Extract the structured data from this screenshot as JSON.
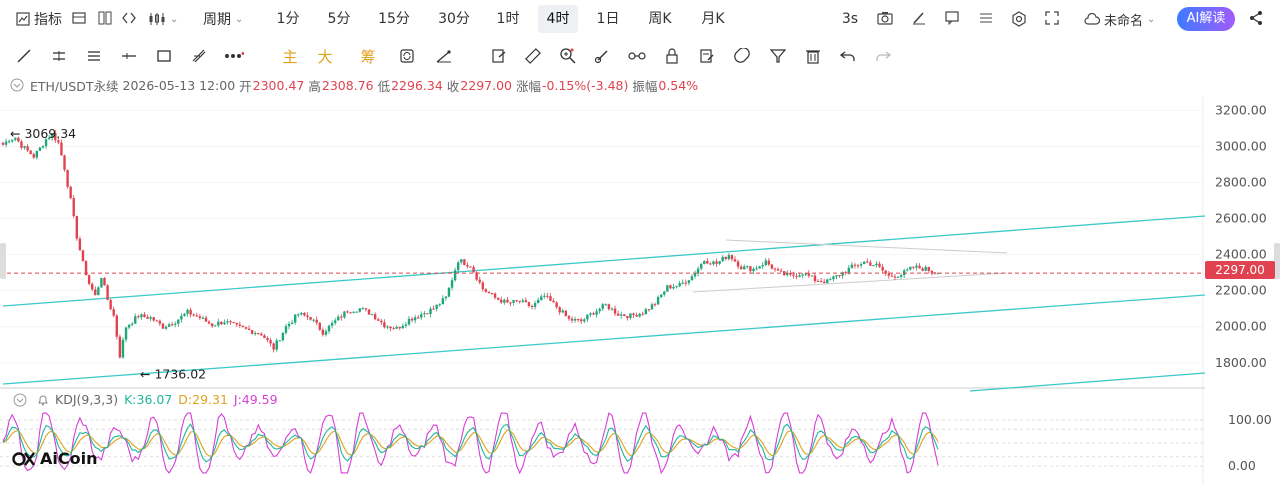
{
  "toolbar": {
    "indicator_label": "指标",
    "period_label": "周期",
    "timeframes": [
      "1分",
      "5分",
      "15分",
      "30分",
      "1时",
      "4时",
      "1日",
      "周K",
      "月K"
    ],
    "active_timeframe": "4时",
    "refresh_label": "3s",
    "layout_name": "未命名",
    "ai_label": "AI解读"
  },
  "draw_tools": {
    "main_label": "主",
    "big_label": "大",
    "chip_label": "筹"
  },
  "info_bar": {
    "symbol": "ETH/USDT永续",
    "datetime": "2026-05-13 12:00",
    "open_label": "开",
    "open": "2300.47",
    "high_label": "高",
    "high": "2308.76",
    "low_label": "低",
    "low": "2296.34",
    "close_label": "收",
    "close": "2297.00",
    "change_label": "涨幅",
    "change": "-0.15%(-3.48)",
    "amplitude_label": "振幅",
    "amplitude": "0.54%"
  },
  "kdj": {
    "title": "KDJ(9,3,3)",
    "k_text": "K:36.07",
    "d_text": "D:29.31",
    "j_text": "J:49.59",
    "k_color": "#1fb89b",
    "d_color": "#e0a21d",
    "j_color": "#d63fd6"
  },
  "brand": {
    "logo_text": "AiCoin"
  },
  "chart_data": {
    "type": "candlestick",
    "ylim": [
      1660,
      3280
    ],
    "y_ticks": [
      "3200.00",
      "3000.00",
      "2800.00",
      "2600.00",
      "2400.00",
      "2200.00",
      "2000.00",
      "1800.00"
    ],
    "y_tick_values": [
      3200,
      3000,
      2800,
      2600,
      2400,
      2200,
      2000,
      1800
    ],
    "last_price": 2297.0,
    "last_price_label": "2297.00",
    "annotations": [
      {
        "label": "3069.34",
        "value": 3069.34
      },
      {
        "label": "1736.02",
        "value": 1736.02
      }
    ],
    "close_path": [
      [
        0,
        3010
      ],
      [
        2,
        3040
      ],
      [
        4,
        3050
      ],
      [
        6,
        3005
      ],
      [
        8,
        2975
      ],
      [
        10,
        2945
      ],
      [
        12,
        2990
      ],
      [
        14,
        3040
      ],
      [
        16,
        3070
      ],
      [
        18,
        3020
      ],
      [
        20,
        2880
      ],
      [
        22,
        2700
      ],
      [
        24,
        2500
      ],
      [
        26,
        2350
      ],
      [
        28,
        2240
      ],
      [
        30,
        2170
      ],
      [
        32,
        2280
      ],
      [
        34,
        2150
      ],
      [
        36,
        2060
      ],
      [
        38,
        1840
      ],
      [
        40,
        2000
      ],
      [
        44,
        2060
      ],
      [
        48,
        2050
      ],
      [
        52,
        2000
      ],
      [
        56,
        2030
      ],
      [
        60,
        2080
      ],
      [
        64,
        2050
      ],
      [
        68,
        2010
      ],
      [
        72,
        2030
      ],
      [
        76,
        2000
      ],
      [
        80,
        1980
      ],
      [
        84,
        1960
      ],
      [
        88,
        1880
      ],
      [
        92,
        2000
      ],
      [
        96,
        2070
      ],
      [
        100,
        2050
      ],
      [
        104,
        1970
      ],
      [
        108,
        2030
      ],
      [
        112,
        2090
      ],
      [
        116,
        2100
      ],
      [
        120,
        2070
      ],
      [
        124,
        2010
      ],
      [
        128,
        1990
      ],
      [
        132,
        2040
      ],
      [
        136,
        2070
      ],
      [
        140,
        2100
      ],
      [
        144,
        2160
      ],
      [
        148,
        2370
      ],
      [
        152,
        2340
      ],
      [
        156,
        2210
      ],
      [
        160,
        2160
      ],
      [
        164,
        2130
      ],
      [
        168,
        2140
      ],
      [
        172,
        2110
      ],
      [
        176,
        2170
      ],
      [
        180,
        2110
      ],
      [
        184,
        2040
      ],
      [
        188,
        2030
      ],
      [
        192,
        2080
      ],
      [
        196,
        2120
      ],
      [
        200,
        2070
      ],
      [
        204,
        2060
      ],
      [
        208,
        2080
      ],
      [
        212,
        2130
      ],
      [
        216,
        2220
      ],
      [
        220,
        2230
      ],
      [
        224,
        2280
      ],
      [
        228,
        2370
      ],
      [
        232,
        2350
      ],
      [
        236,
        2400
      ],
      [
        240,
        2330
      ],
      [
        244,
        2320
      ],
      [
        248,
        2360
      ],
      [
        252,
        2300
      ],
      [
        256,
        2280
      ],
      [
        260,
        2300
      ],
      [
        264,
        2260
      ],
      [
        268,
        2250
      ],
      [
        272,
        2290
      ],
      [
        276,
        2330
      ],
      [
        280,
        2360
      ],
      [
        284,
        2340
      ],
      [
        288,
        2280
      ],
      [
        292,
        2290
      ],
      [
        296,
        2330
      ],
      [
        300,
        2320
      ],
      [
        304,
        2297
      ]
    ],
    "kdj_ticks": [
      "100.00",
      "0.00"
    ],
    "kdj_tick_values": [
      100,
      0
    ]
  }
}
